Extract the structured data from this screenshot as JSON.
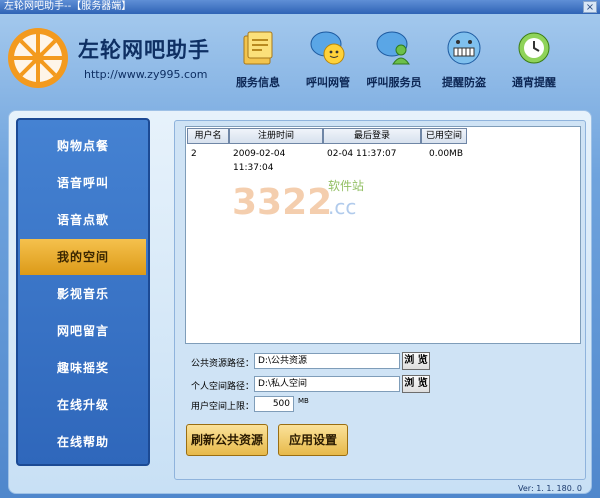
{
  "window": {
    "title": "左轮网吧助手--【服务器端】",
    "close_glyph": "×"
  },
  "header": {
    "brand": "左轮网吧助手",
    "url": "http://www.zy995.com"
  },
  "toolbar": [
    {
      "label": "服务信息",
      "icon": "notes-icon"
    },
    {
      "label": "呼叫网管",
      "icon": "smiley-chat-icon"
    },
    {
      "label": "呼叫服务员",
      "icon": "user-chat-icon"
    },
    {
      "label": "提醒防盗",
      "icon": "alarm-face-icon"
    },
    {
      "label": "通宵提醒",
      "icon": "clock-icon"
    }
  ],
  "sidebar": {
    "items": [
      "购物点餐",
      "语音呼叫",
      "语音点歌",
      "我的空间",
      "影视音乐",
      "网吧留言",
      "趣味摇奖",
      "在线升级",
      "在线帮助"
    ],
    "active_index": 3
  },
  "table": {
    "columns": [
      "用户名",
      "注册时间",
      "最后登录",
      "已用空间"
    ],
    "rows": [
      {
        "user": "2",
        "registered": "2009-02-04 11:37:04",
        "last_login": "02-04 11:37:07",
        "used": "0.00MB"
      }
    ]
  },
  "watermark": {
    "number": "3322",
    "suffix": ".cc",
    "cn": "软件站"
  },
  "settings": {
    "public_path_label": "公共资源路径：",
    "public_path_value": "D:\\公共资源",
    "personal_path_label": "个人空间路径：",
    "personal_path_value": "D:\\私人空间",
    "quota_label": "用户空间上限：",
    "quota_value": "500",
    "quota_unit": "MB",
    "browse_label": "浏 览"
  },
  "buttons": {
    "refresh": "刷新公共资源",
    "apply": "应用设置"
  },
  "version": "Ver: 1. 1. 180. 0",
  "colors": {
    "accent_orange": "#f39a1e",
    "active_nav": "#e2a225",
    "sidebar_blue": "#3a74c6"
  }
}
